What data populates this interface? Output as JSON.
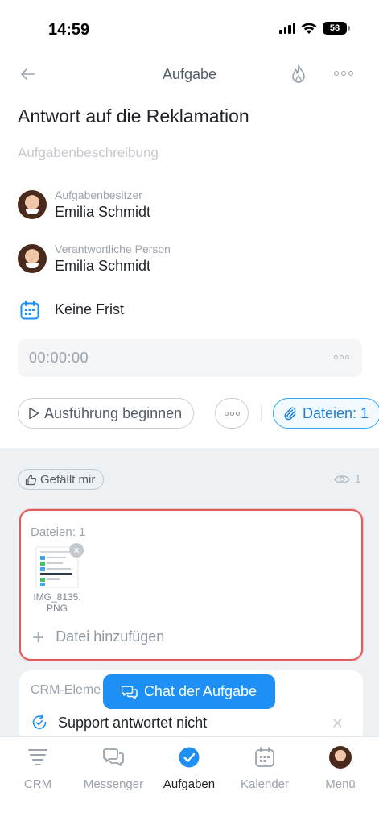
{
  "status_bar": {
    "time": "14:59",
    "battery": "58"
  },
  "header": {
    "title": "Aufgabe"
  },
  "task": {
    "title": "Antwort auf die Reklamation",
    "description_placeholder": "Aufgabenbeschreibung"
  },
  "people": [
    {
      "role": "Aufgabenbesitzer",
      "name": "Emilia Schmidt"
    },
    {
      "role": "Verantwortliche Person",
      "name": "Emilia Schmidt"
    }
  ],
  "deadline": {
    "label": "Keine Frist"
  },
  "timer": {
    "value": "00:00:00"
  },
  "actions": {
    "start_label": "Ausführung beginnen",
    "files_label": "Dateien: 1"
  },
  "social": {
    "like_label": "Gefällt mir",
    "views_count": "1"
  },
  "files": {
    "count_label": "Dateien: 1",
    "items": [
      {
        "name": "IMG_8135.\nPNG"
      }
    ],
    "add_label": "Datei hinzufügen"
  },
  "crm": {
    "title": "CRM-Eleme",
    "items": [
      {
        "label": "Support antwortet nicht"
      }
    ]
  },
  "chat_button": {
    "label": "Chat der Aufgabe"
  },
  "tab_bar": {
    "tabs": [
      {
        "label": "CRM",
        "icon": "crm-icon"
      },
      {
        "label": "Messenger",
        "icon": "messenger-icon"
      },
      {
        "label": "Aufgaben",
        "icon": "tasks-check-icon",
        "active": true
      },
      {
        "label": "Kalender",
        "icon": "calendar-icon"
      },
      {
        "label": "Menü",
        "icon": "avatar"
      }
    ]
  },
  "colors": {
    "accent": "#1e8ff5",
    "highlight": "#e05c5c",
    "muted": "#9aa3ad"
  }
}
